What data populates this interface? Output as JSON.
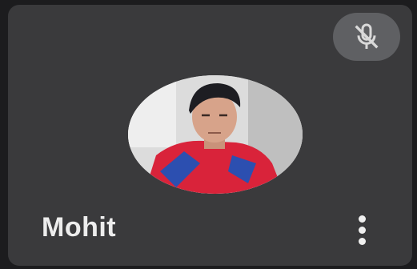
{
  "participant": {
    "name": "Mohit",
    "muted": true,
    "mic_icon": "mic-off-icon",
    "avatar_icon": "participant-photo",
    "menu_icon": "more-vertical-icon"
  },
  "colors": {
    "tile_background": "#3a3a3c",
    "page_background": "#1c1c1e",
    "badge_background": "#5f6063",
    "name_text": "#ededed"
  }
}
